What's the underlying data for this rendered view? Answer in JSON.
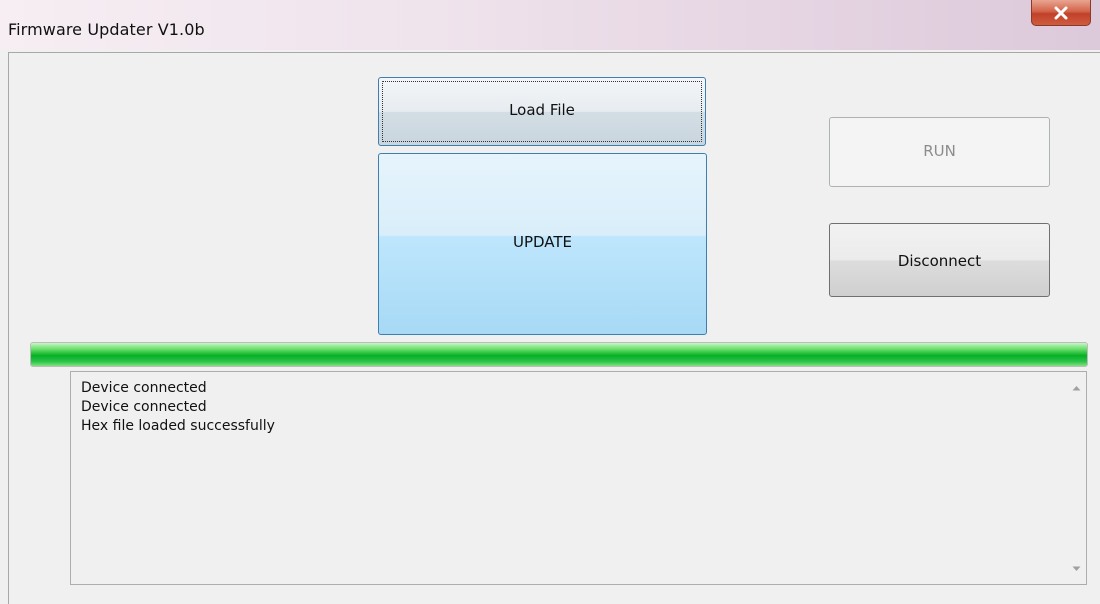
{
  "window": {
    "title": "Firmware Updater V1.0b",
    "close_icon": "close-x-icon"
  },
  "buttons": {
    "load_file": "Load File",
    "update": "UPDATE",
    "run": "RUN",
    "disconnect": "Disconnect"
  },
  "progress": {
    "percent": 100
  },
  "log": {
    "lines": [
      "Device connected",
      "Device connected",
      "Hex file loaded successfully"
    ]
  },
  "colors": {
    "progress_green": "#06b025",
    "button_focus_border": "#3c7fb1",
    "close_red": "#c0412a"
  }
}
